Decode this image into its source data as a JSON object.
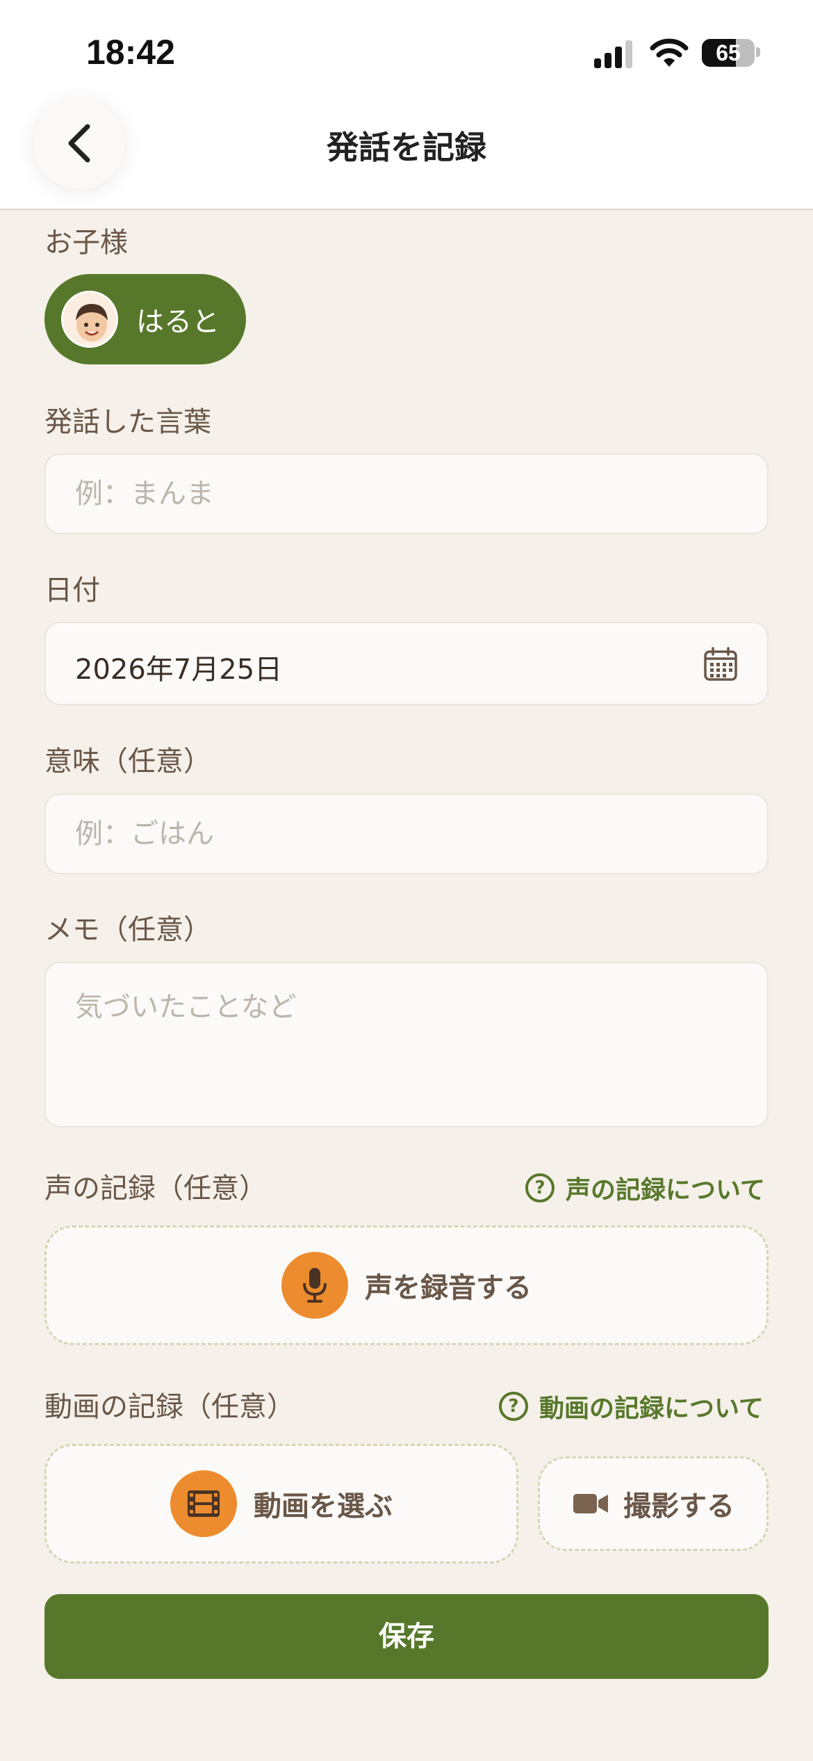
{
  "status_bar": {
    "time": "18:42",
    "battery": "65",
    "battery_level": 0.65
  },
  "header": {
    "title": "発話を記録"
  },
  "child": {
    "label": "お子様",
    "name": "はると"
  },
  "word": {
    "label": "発話した言葉",
    "placeholder": "例：まんま",
    "value": ""
  },
  "date": {
    "label": "日付",
    "value": "2026年7月25日"
  },
  "meaning": {
    "label": "意味（任意）",
    "placeholder": "例：ごはん",
    "value": ""
  },
  "memo": {
    "label": "メモ（任意）",
    "placeholder": "気づいたことなど",
    "value": ""
  },
  "voice": {
    "label": "声の記録（任意）",
    "help_label": "声の記録について",
    "record_button": "声を録音する"
  },
  "video": {
    "label": "動画の記録（任意）",
    "help_label": "動画の記録について",
    "choose_button": "動画を選ぶ",
    "shoot_button": "撮影する"
  },
  "save_button": "保存",
  "colors": {
    "accent_green": "#57782b",
    "accent_orange": "#ec8c2e",
    "background": "#f5f0e9"
  },
  "icons": {
    "back": "chevron-left-icon",
    "calendar": "calendar-icon",
    "help": "question-circle-icon",
    "mic": "microphone-icon",
    "film": "film-icon",
    "camera": "video-camera-icon"
  }
}
